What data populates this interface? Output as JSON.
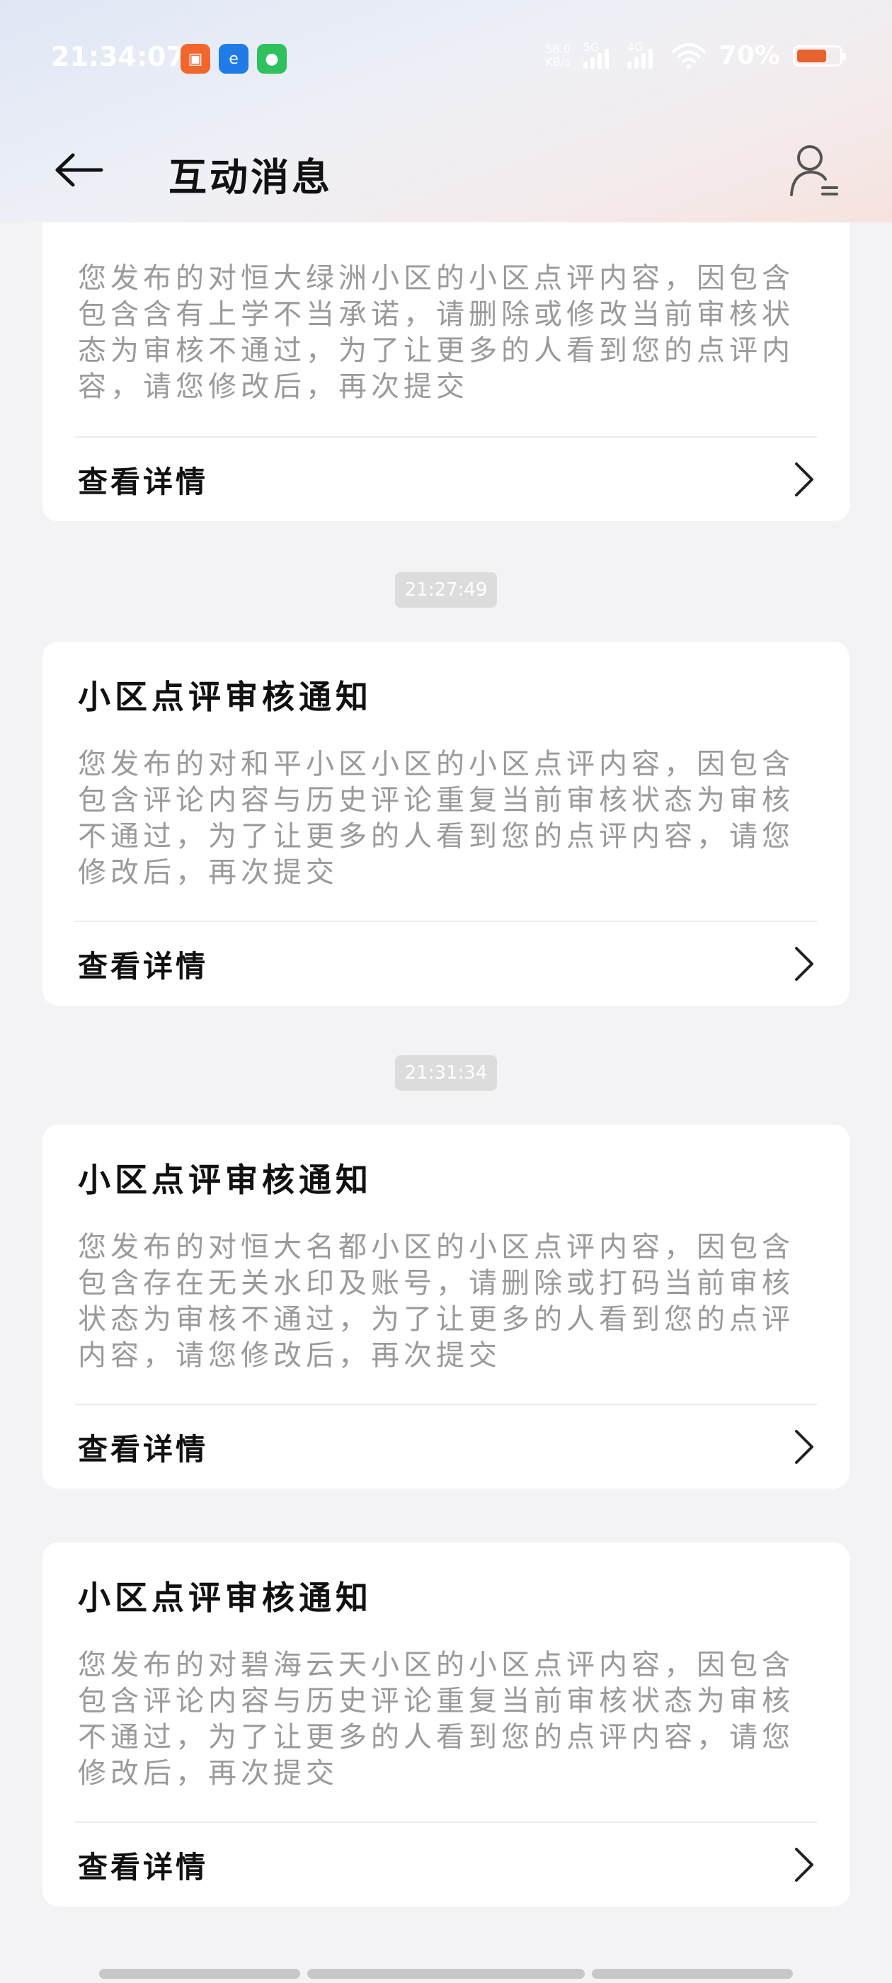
{
  "status_bar": {
    "time": "21:34:07",
    "net_speed_value": "56.0",
    "net_speed_unit": "KB/s",
    "sig1_label": "5G",
    "sig2_label": "4G",
    "battery_percent": "70%",
    "battery_level": 0.7,
    "battery_color": "#e8622d"
  },
  "header": {
    "title": "互动消息"
  },
  "cards": [
    {
      "title": "",
      "body": "您发布的对恒大绿洲小区的小区点评内容，因包含包含含有上学不当承诺，请删除或修改当前审核状态为审核不通过，为了让更多的人看到您的点评内容，请您修改后，再次提交",
      "detail_label": "查看详情"
    },
    {
      "title": "小区点评审核通知",
      "body": "您发布的对和平小区小区的小区点评内容，因包含包含评论内容与历史评论重复当前审核状态为审核不通过，为了让更多的人看到您的点评内容，请您修改后，再次提交",
      "detail_label": "查看详情"
    },
    {
      "title": "小区点评审核通知",
      "body": "您发布的对恒大名都小区的小区点评内容，因包含包含存在无关水印及账号，请删除或打码当前审核状态为审核不通过，为了让更多的人看到您的点评内容，请您修改后，再次提交",
      "detail_label": "查看详情"
    },
    {
      "title": "小区点评审核通知",
      "body": "您发布的对碧海云天小区的小区点评内容，因包含包含评论内容与历史评论重复当前审核状态为审核不通过，为了让更多的人看到您的点评内容，请您修改后，再次提交",
      "detail_label": "查看详情"
    }
  ],
  "timestamps": [
    "21:27:49",
    "21:31:34"
  ],
  "icons": {
    "back": "arrow-left-icon",
    "profile": "user-icon",
    "chevron": "chevron-right-icon"
  }
}
